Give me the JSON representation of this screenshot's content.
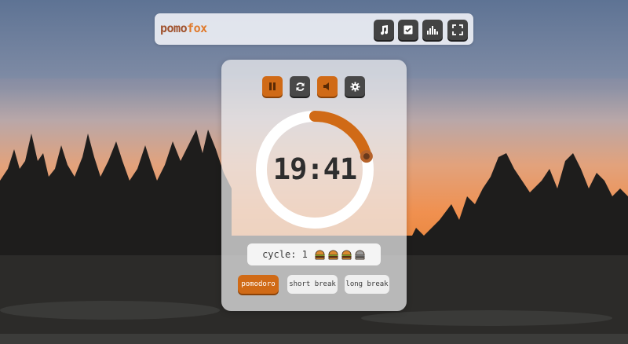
{
  "brand": {
    "part1": "pomo",
    "part2": "fox"
  },
  "toolbar": {
    "buttons": [
      {
        "icon": "music-icon"
      },
      {
        "icon": "checklist-icon"
      },
      {
        "icon": "equalizer-icon"
      },
      {
        "icon": "fullscreen-icon"
      }
    ]
  },
  "controls": [
    {
      "icon": "pause-icon",
      "state": "active"
    },
    {
      "icon": "refresh-icon",
      "state": "normal"
    },
    {
      "icon": "volume-muted-icon",
      "state": "active"
    },
    {
      "icon": "gear-icon",
      "state": "normal"
    }
  ],
  "timer": {
    "display": "19:41",
    "progress_fraction": 0.21
  },
  "cycle": {
    "label": "cycle:",
    "count": "1",
    "burgers_total": 4,
    "burgers_done": 3
  },
  "modes": [
    {
      "label": "pomodoro",
      "active": true
    },
    {
      "label": "short break",
      "active": false
    },
    {
      "label": "long break",
      "active": false
    }
  ],
  "colors": {
    "accent": "#d06a16",
    "dark_button": "#484848",
    "logo_dark": "#a0522d",
    "logo_light": "#e07a2c"
  }
}
